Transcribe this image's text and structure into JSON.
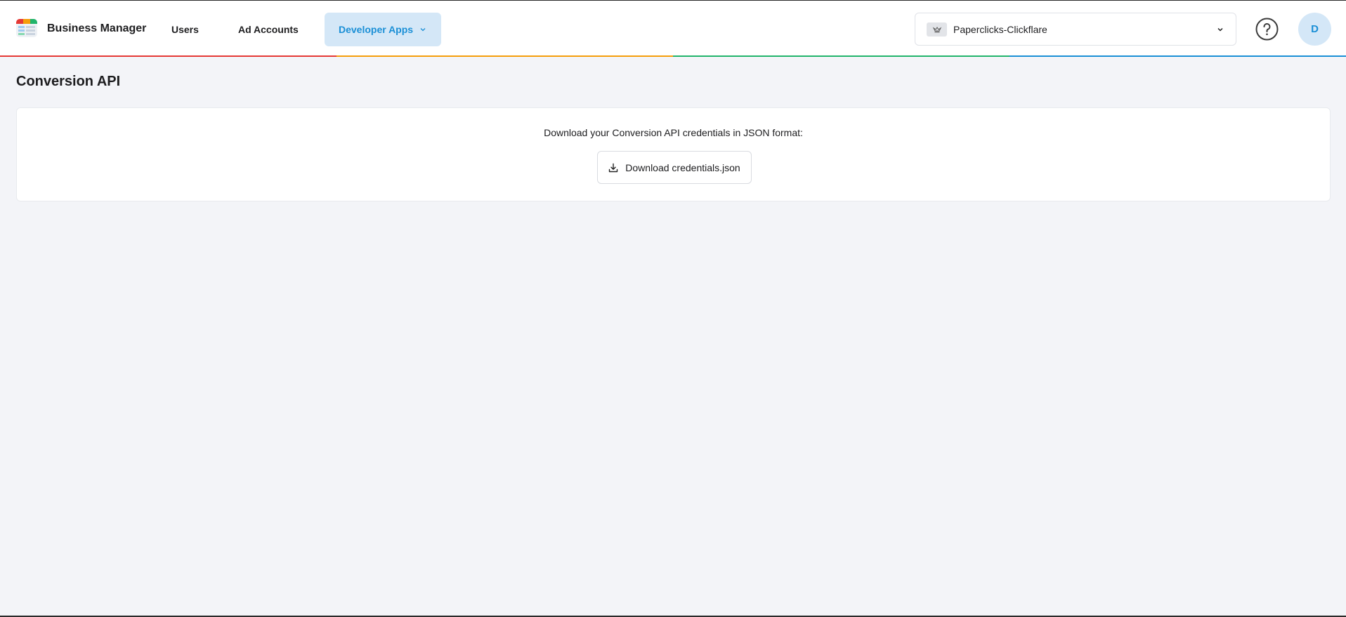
{
  "header": {
    "brand": "Business Manager",
    "nav": {
      "users": "Users",
      "ad_accounts": "Ad Accounts",
      "developer_apps": "Developer Apps"
    },
    "account_selector": {
      "selected": "Paperclicks-Clickflare"
    },
    "avatar_initial": "D",
    "stripe_colors": [
      "#e53935",
      "#f59e0b",
      "#22b46b",
      "#1a8fd6"
    ]
  },
  "page": {
    "title": "Conversion API"
  },
  "card": {
    "description": "Download your Conversion API credentials in JSON format:",
    "download_label": "Download credentials.json"
  },
  "icons": {
    "logo": "app-logo-icon",
    "account": "briefcase-icon",
    "help": "help-circle-icon",
    "download": "download-icon"
  }
}
